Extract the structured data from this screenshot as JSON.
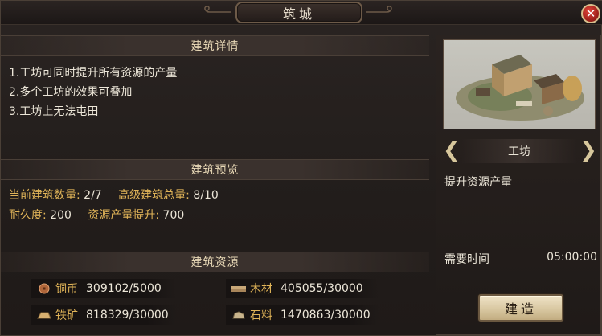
{
  "window": {
    "title": "筑城",
    "close_icon": "close-icon"
  },
  "details": {
    "header": "建筑详情",
    "lines": [
      "1.工坊可同时提升所有资源的产量",
      "2.多个工坊的效果可叠加",
      "3.工坊上无法屯田"
    ]
  },
  "preview": {
    "header": "建筑预览",
    "current_count_label": "当前建筑数量:",
    "current_count_value": "2/7",
    "advanced_total_label": "高级建筑总量:",
    "advanced_total_value": "8/10",
    "durability_label": "耐久度:",
    "durability_value": "200",
    "production_boost_label": "资源产量提升:",
    "production_boost_value": "700"
  },
  "resources": {
    "header": "建筑资源",
    "items": [
      {
        "name": "铜币",
        "value": "309102/5000",
        "icon": "copper-coin-icon"
      },
      {
        "name": "木材",
        "value": "405055/30000",
        "icon": "wood-icon"
      },
      {
        "name": "铁矿",
        "value": "818329/30000",
        "icon": "iron-ore-icon"
      },
      {
        "name": "石料",
        "value": "1470863/30000",
        "icon": "stone-icon"
      }
    ]
  },
  "building": {
    "name": "工坊",
    "description": "提升资源产量",
    "time_label": "需要时间",
    "time_value": "05:00:00",
    "build_label": "建造"
  },
  "colors": {
    "label_gold": "#e0b458",
    "text": "#ece6d8",
    "close_red": "#c5302a"
  }
}
